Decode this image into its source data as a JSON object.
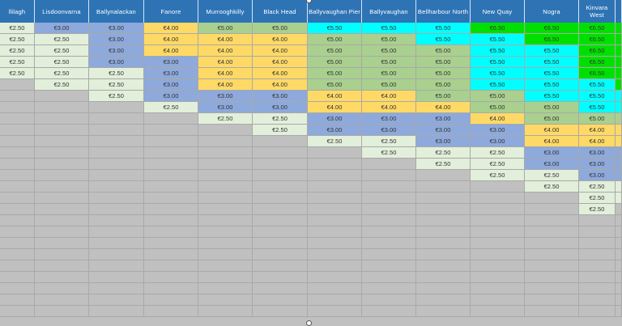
{
  "columns": [
    "llilagh",
    "Lisdoonvarna",
    "Ballynalackan",
    "Fanore",
    "Murrooghkilly",
    "Black Head",
    "Ballyvaughan Pier",
    "Ballyvaughan",
    "Bellharbour North",
    "New Quay",
    "Nogra",
    "Kinvara West",
    ""
  ],
  "colors": {
    "header": "#2e74b5",
    "light_green": "#e2efda",
    "blue": "#8ea9db",
    "orange": "#ffd966",
    "green": "#a9d08e",
    "cyan": "#00ffff",
    "bright_green": "#00e000",
    "empty": "#c0c0c0"
  },
  "rows": [
    [
      [
        "€2.50",
        "g"
      ],
      [
        "€3.00",
        "b"
      ],
      [
        "€3.00",
        "b"
      ],
      [
        "€4.00",
        "o"
      ],
      [
        "€5.00",
        "G"
      ],
      [
        "€5.00",
        "G"
      ],
      [
        "€5.50",
        "c"
      ],
      [
        "€5.50",
        "c"
      ],
      [
        "€5.50",
        "c"
      ],
      [
        "€6.50",
        "B"
      ],
      [
        "€6.50",
        "B"
      ],
      [
        "€6.50",
        "B"
      ],
      [
        "",
        "B"
      ]
    ],
    [
      [
        "€2.50",
        "g"
      ],
      [
        "€2.50",
        "g"
      ],
      [
        "€3.00",
        "b"
      ],
      [
        "€4.00",
        "o"
      ],
      [
        "€4.00",
        "o"
      ],
      [
        "€4.00",
        "o"
      ],
      [
        "€5.00",
        "G"
      ],
      [
        "€5.00",
        "G"
      ],
      [
        "€5.50",
        "c"
      ],
      [
        "€5.50",
        "c"
      ],
      [
        "€6.50",
        "B"
      ],
      [
        "€6.50",
        "B"
      ],
      [
        "",
        "B"
      ]
    ],
    [
      [
        "€2.50",
        "g"
      ],
      [
        "€2.50",
        "g"
      ],
      [
        "€3.00",
        "b"
      ],
      [
        "€4.00",
        "o"
      ],
      [
        "€4.00",
        "o"
      ],
      [
        "€4.00",
        "o"
      ],
      [
        "€5.00",
        "G"
      ],
      [
        "€5.00",
        "G"
      ],
      [
        "€5.00",
        "G"
      ],
      [
        "€5.50",
        "c"
      ],
      [
        "€5.50",
        "c"
      ],
      [
        "€6.50",
        "B"
      ],
      [
        "",
        "B"
      ]
    ],
    [
      [
        "€2.50",
        "g"
      ],
      [
        "€2.50",
        "g"
      ],
      [
        "€3.00",
        "b"
      ],
      [
        "€3.00",
        "b"
      ],
      [
        "€4.00",
        "o"
      ],
      [
        "€4.00",
        "o"
      ],
      [
        "€5.00",
        "G"
      ],
      [
        "€5.00",
        "G"
      ],
      [
        "€5.00",
        "G"
      ],
      [
        "€5.50",
        "c"
      ],
      [
        "€5.50",
        "c"
      ],
      [
        "€6.50",
        "B"
      ],
      [
        "",
        "B"
      ]
    ],
    [
      [
        "€2.50",
        "g"
      ],
      [
        "€2.50",
        "g"
      ],
      [
        "€2.50",
        "g"
      ],
      [
        "€3.00",
        "b"
      ],
      [
        "€4.00",
        "o"
      ],
      [
        "€4.00",
        "o"
      ],
      [
        "€5.00",
        "G"
      ],
      [
        "€5.00",
        "G"
      ],
      [
        "€5.00",
        "G"
      ],
      [
        "€5.50",
        "c"
      ],
      [
        "€5.50",
        "c"
      ],
      [
        "€6.50",
        "B"
      ],
      [
        "",
        "B"
      ]
    ],
    [
      [
        "",
        "e"
      ],
      [
        "€2.50",
        "g"
      ],
      [
        "€2.50",
        "g"
      ],
      [
        "€3.00",
        "b"
      ],
      [
        "€4.00",
        "o"
      ],
      [
        "€4.00",
        "o"
      ],
      [
        "€5.00",
        "G"
      ],
      [
        "€5.00",
        "G"
      ],
      [
        "€5.00",
        "G"
      ],
      [
        "€5.50",
        "c"
      ],
      [
        "€5.50",
        "c"
      ],
      [
        "€5.50",
        "c"
      ],
      [
        "",
        "B"
      ]
    ],
    [
      [
        "",
        "e"
      ],
      [
        "",
        "e"
      ],
      [
        "€2.50",
        "g"
      ],
      [
        "€3.00",
        "b"
      ],
      [
        "€3.00",
        "b"
      ],
      [
        "€3.00",
        "b"
      ],
      [
        "€4.00",
        "o"
      ],
      [
        "€4.00",
        "o"
      ],
      [
        "€5.00",
        "G"
      ],
      [
        "€5.00",
        "G"
      ],
      [
        "€5.50",
        "c"
      ],
      [
        "€5.50",
        "c"
      ],
      [
        "",
        "c"
      ]
    ],
    [
      [
        "",
        "e"
      ],
      [
        "",
        "e"
      ],
      [
        "",
        "e"
      ],
      [
        "€2.50",
        "g"
      ],
      [
        "€3.00",
        "b"
      ],
      [
        "€3.00",
        "b"
      ],
      [
        "€4.00",
        "o"
      ],
      [
        "€4.00",
        "o"
      ],
      [
        "€4.00",
        "o"
      ],
      [
        "€5.00",
        "G"
      ],
      [
        "€5.00",
        "G"
      ],
      [
        "€5.50",
        "c"
      ],
      [
        "",
        "c"
      ]
    ],
    [
      [
        "",
        "e"
      ],
      [
        "",
        "e"
      ],
      [
        "",
        "e"
      ],
      [
        "",
        "e"
      ],
      [
        "€2.50",
        "g"
      ],
      [
        "€2.50",
        "g"
      ],
      [
        "€3.00",
        "b"
      ],
      [
        "€3.00",
        "b"
      ],
      [
        "€3.00",
        "b"
      ],
      [
        "€4.00",
        "o"
      ],
      [
        "€5.00",
        "G"
      ],
      [
        "€5.00",
        "G"
      ],
      [
        "",
        "G"
      ]
    ],
    [
      [
        "",
        "e"
      ],
      [
        "",
        "e"
      ],
      [
        "",
        "e"
      ],
      [
        "",
        "e"
      ],
      [
        "",
        "e"
      ],
      [
        "€2.50",
        "g"
      ],
      [
        "€3.00",
        "b"
      ],
      [
        "€3.00",
        "b"
      ],
      [
        "€3.00",
        "b"
      ],
      [
        "€3.00",
        "b"
      ],
      [
        "€4.00",
        "o"
      ],
      [
        "€4.00",
        "o"
      ],
      [
        "",
        "o"
      ]
    ],
    [
      [
        "",
        "e"
      ],
      [
        "",
        "e"
      ],
      [
        "",
        "e"
      ],
      [
        "",
        "e"
      ],
      [
        "",
        "e"
      ],
      [
        "",
        "e"
      ],
      [
        "€2.50",
        "g"
      ],
      [
        "€2.50",
        "g"
      ],
      [
        "€3.00",
        "b"
      ],
      [
        "€3.00",
        "b"
      ],
      [
        "€4.00",
        "o"
      ],
      [
        "€4.00",
        "o"
      ],
      [
        "",
        "o"
      ]
    ],
    [
      [
        "",
        "e"
      ],
      [
        "",
        "e"
      ],
      [
        "",
        "e"
      ],
      [
        "",
        "e"
      ],
      [
        "",
        "e"
      ],
      [
        "",
        "e"
      ],
      [
        "",
        "e"
      ],
      [
        "€2.50",
        "g"
      ],
      [
        "€2.50",
        "g"
      ],
      [
        "€2.50",
        "g"
      ],
      [
        "€3.00",
        "b"
      ],
      [
        "€3.00",
        "b"
      ],
      [
        "",
        "b"
      ]
    ],
    [
      [
        "",
        "e"
      ],
      [
        "",
        "e"
      ],
      [
        "",
        "e"
      ],
      [
        "",
        "e"
      ],
      [
        "",
        "e"
      ],
      [
        "",
        "e"
      ],
      [
        "",
        "e"
      ],
      [
        "",
        "e"
      ],
      [
        "€2.50",
        "g"
      ],
      [
        "€2.50",
        "g"
      ],
      [
        "€3.00",
        "b"
      ],
      [
        "€3.00",
        "b"
      ],
      [
        "",
        "b"
      ]
    ],
    [
      [
        "",
        "e"
      ],
      [
        "",
        "e"
      ],
      [
        "",
        "e"
      ],
      [
        "",
        "e"
      ],
      [
        "",
        "e"
      ],
      [
        "",
        "e"
      ],
      [
        "",
        "e"
      ],
      [
        "",
        "e"
      ],
      [
        "",
        "e"
      ],
      [
        "€2.50",
        "g"
      ],
      [
        "€2.50",
        "g"
      ],
      [
        "€3.00",
        "b"
      ],
      [
        "",
        "b"
      ]
    ],
    [
      [
        "",
        "e"
      ],
      [
        "",
        "e"
      ],
      [
        "",
        "e"
      ],
      [
        "",
        "e"
      ],
      [
        "",
        "e"
      ],
      [
        "",
        "e"
      ],
      [
        "",
        "e"
      ],
      [
        "",
        "e"
      ],
      [
        "",
        "e"
      ],
      [
        "",
        "e"
      ],
      [
        "€2.50",
        "g"
      ],
      [
        "€2.50",
        "g"
      ],
      [
        "",
        "g"
      ]
    ],
    [
      [
        "",
        "e"
      ],
      [
        "",
        "e"
      ],
      [
        "",
        "e"
      ],
      [
        "",
        "e"
      ],
      [
        "",
        "e"
      ],
      [
        "",
        "e"
      ],
      [
        "",
        "e"
      ],
      [
        "",
        "e"
      ],
      [
        "",
        "e"
      ],
      [
        "",
        "e"
      ],
      [
        "",
        "e"
      ],
      [
        "€2.50",
        "g"
      ],
      [
        "",
        "g"
      ]
    ],
    [
      [
        "",
        "e"
      ],
      [
        "",
        "e"
      ],
      [
        "",
        "e"
      ],
      [
        "",
        "e"
      ],
      [
        "",
        "e"
      ],
      [
        "",
        "e"
      ],
      [
        "",
        "e"
      ],
      [
        "",
        "e"
      ],
      [
        "",
        "e"
      ],
      [
        "",
        "e"
      ],
      [
        "",
        "e"
      ],
      [
        "€2.50",
        "g"
      ],
      [
        "",
        "e"
      ]
    ],
    [
      [
        "",
        "e"
      ],
      [
        "",
        "e"
      ],
      [
        "",
        "e"
      ],
      [
        "",
        "e"
      ],
      [
        "",
        "e"
      ],
      [
        "",
        "e"
      ],
      [
        "",
        "e"
      ],
      [
        "",
        "e"
      ],
      [
        "",
        "e"
      ],
      [
        "",
        "e"
      ],
      [
        "",
        "e"
      ],
      [
        "",
        "e"
      ],
      [
        "",
        "e"
      ]
    ],
    [
      [
        "",
        "e"
      ],
      [
        "",
        "e"
      ],
      [
        "",
        "e"
      ],
      [
        "",
        "e"
      ],
      [
        "",
        "e"
      ],
      [
        "",
        "e"
      ],
      [
        "",
        "e"
      ],
      [
        "",
        "e"
      ],
      [
        "",
        "e"
      ],
      [
        "",
        "e"
      ],
      [
        "",
        "e"
      ],
      [
        "",
        "e"
      ],
      [
        "",
        "e"
      ]
    ],
    [
      [
        "",
        "e"
      ],
      [
        "",
        "e"
      ],
      [
        "",
        "e"
      ],
      [
        "",
        "e"
      ],
      [
        "",
        "e"
      ],
      [
        "",
        "e"
      ],
      [
        "",
        "e"
      ],
      [
        "",
        "e"
      ],
      [
        "",
        "e"
      ],
      [
        "",
        "e"
      ],
      [
        "",
        "e"
      ],
      [
        "",
        "e"
      ],
      [
        "",
        "e"
      ]
    ],
    [
      [
        "",
        "e"
      ],
      [
        "",
        "e"
      ],
      [
        "",
        "e"
      ],
      [
        "",
        "e"
      ],
      [
        "",
        "e"
      ],
      [
        "",
        "e"
      ],
      [
        "",
        "e"
      ],
      [
        "",
        "e"
      ],
      [
        "",
        "e"
      ],
      [
        "",
        "e"
      ],
      [
        "",
        "e"
      ],
      [
        "",
        "e"
      ],
      [
        "",
        "e"
      ]
    ],
    [
      [
        "",
        "e"
      ],
      [
        "",
        "e"
      ],
      [
        "",
        "e"
      ],
      [
        "",
        "e"
      ],
      [
        "",
        "e"
      ],
      [
        "",
        "e"
      ],
      [
        "",
        "e"
      ],
      [
        "",
        "e"
      ],
      [
        "",
        "e"
      ],
      [
        "",
        "e"
      ],
      [
        "",
        "e"
      ],
      [
        "",
        "e"
      ],
      [
        "",
        "e"
      ]
    ],
    [
      [
        "",
        "e"
      ],
      [
        "",
        "e"
      ],
      [
        "",
        "e"
      ],
      [
        "",
        "e"
      ],
      [
        "",
        "e"
      ],
      [
        "",
        "e"
      ],
      [
        "",
        "e"
      ],
      [
        "",
        "e"
      ],
      [
        "",
        "e"
      ],
      [
        "",
        "e"
      ],
      [
        "",
        "e"
      ],
      [
        "",
        "e"
      ],
      [
        "",
        "e"
      ]
    ],
    [
      [
        "",
        "e"
      ],
      [
        "",
        "e"
      ],
      [
        "",
        "e"
      ],
      [
        "",
        "e"
      ],
      [
        "",
        "e"
      ],
      [
        "",
        "e"
      ],
      [
        "",
        "e"
      ],
      [
        "",
        "e"
      ],
      [
        "",
        "e"
      ],
      [
        "",
        "e"
      ],
      [
        "",
        "e"
      ],
      [
        "",
        "e"
      ],
      [
        "",
        "e"
      ]
    ],
    [
      [
        "",
        "e"
      ],
      [
        "",
        "e"
      ],
      [
        "",
        "e"
      ],
      [
        "",
        "e"
      ],
      [
        "",
        "e"
      ],
      [
        "",
        "e"
      ],
      [
        "",
        "e"
      ],
      [
        "",
        "e"
      ],
      [
        "",
        "e"
      ],
      [
        "",
        "e"
      ],
      [
        "",
        "e"
      ],
      [
        "",
        "e"
      ],
      [
        "",
        "e"
      ]
    ],
    [
      [
        "",
        "e"
      ],
      [
        "",
        "e"
      ],
      [
        "",
        "e"
      ],
      [
        "",
        "e"
      ],
      [
        "",
        "e"
      ],
      [
        "",
        "e"
      ],
      [
        "",
        "e"
      ],
      [
        "",
        "e"
      ],
      [
        "",
        "e"
      ],
      [
        "",
        "e"
      ],
      [
        "",
        "e"
      ],
      [
        "",
        "e"
      ],
      [
        "",
        "e"
      ]
    ]
  ]
}
